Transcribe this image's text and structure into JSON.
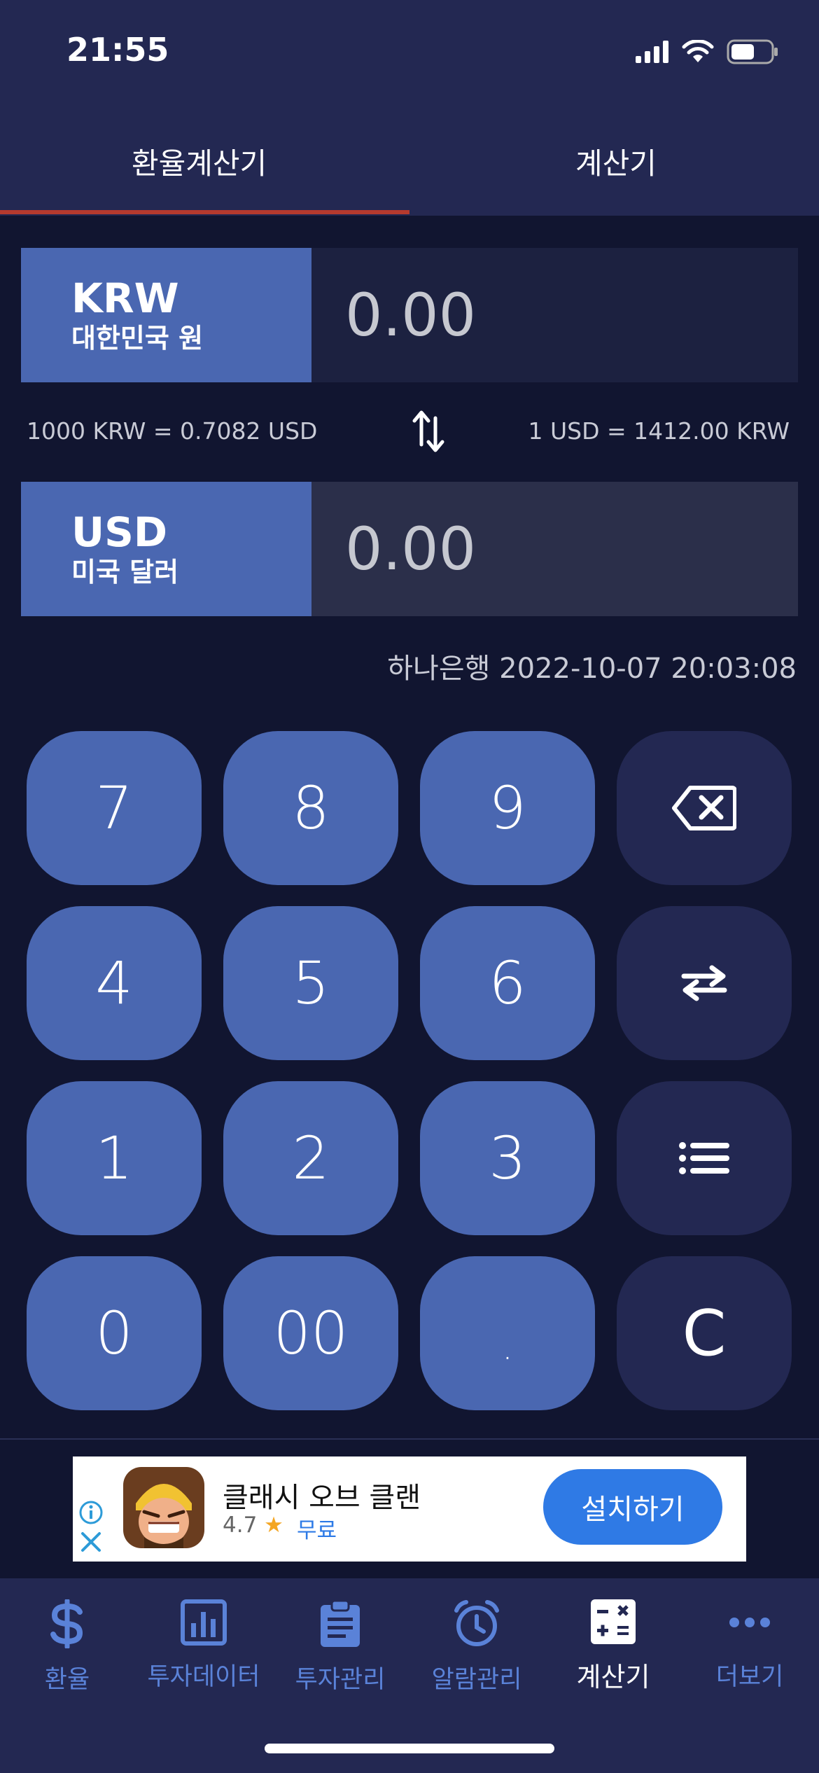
{
  "status_bar": {
    "time": "21:55"
  },
  "tabs": [
    {
      "label": "환율계산기",
      "active": true
    },
    {
      "label": "계산기",
      "active": false
    }
  ],
  "from_currency": {
    "code": "KRW",
    "name": "대한민국 원",
    "value": "0.00"
  },
  "to_currency": {
    "code": "USD",
    "name": "미국 달러",
    "value": "0.00"
  },
  "rates": {
    "left": "1000 KRW = 0.7082 USD",
    "right": "1 USD = 1412.00 KRW"
  },
  "source": "하나은행 2022-10-07 20:03:08",
  "keypad": {
    "k7": "7",
    "k8": "8",
    "k9": "9",
    "k4": "4",
    "k5": "5",
    "k6": "6",
    "k1": "1",
    "k2": "2",
    "k3": "3",
    "k0": "0",
    "k00": "00",
    "kdot": ".",
    "kclear": "C",
    "icons": [
      "backspace-icon",
      "swap-icon",
      "list-icon"
    ]
  },
  "ad": {
    "title": "클래시 오브 클랜",
    "rating": "4.7",
    "price": "무료",
    "button": "설치하기"
  },
  "bottom_nav": [
    {
      "label": "환율",
      "icon": "dollar-icon",
      "active": false
    },
    {
      "label": "투자데이터",
      "icon": "chart-icon",
      "active": false
    },
    {
      "label": "투자관리",
      "icon": "clipboard-icon",
      "active": false
    },
    {
      "label": "알람관리",
      "icon": "alarm-icon",
      "active": false
    },
    {
      "label": "계산기",
      "icon": "calculator-icon",
      "active": true
    },
    {
      "label": "더보기",
      "icon": "more-icon",
      "active": false
    }
  ],
  "colors": {
    "accent": "#4a67b1",
    "background": "#111530",
    "surface": "#232852",
    "tab_indicator": "#b53a2e",
    "nav_inactive": "#5a82d8"
  }
}
